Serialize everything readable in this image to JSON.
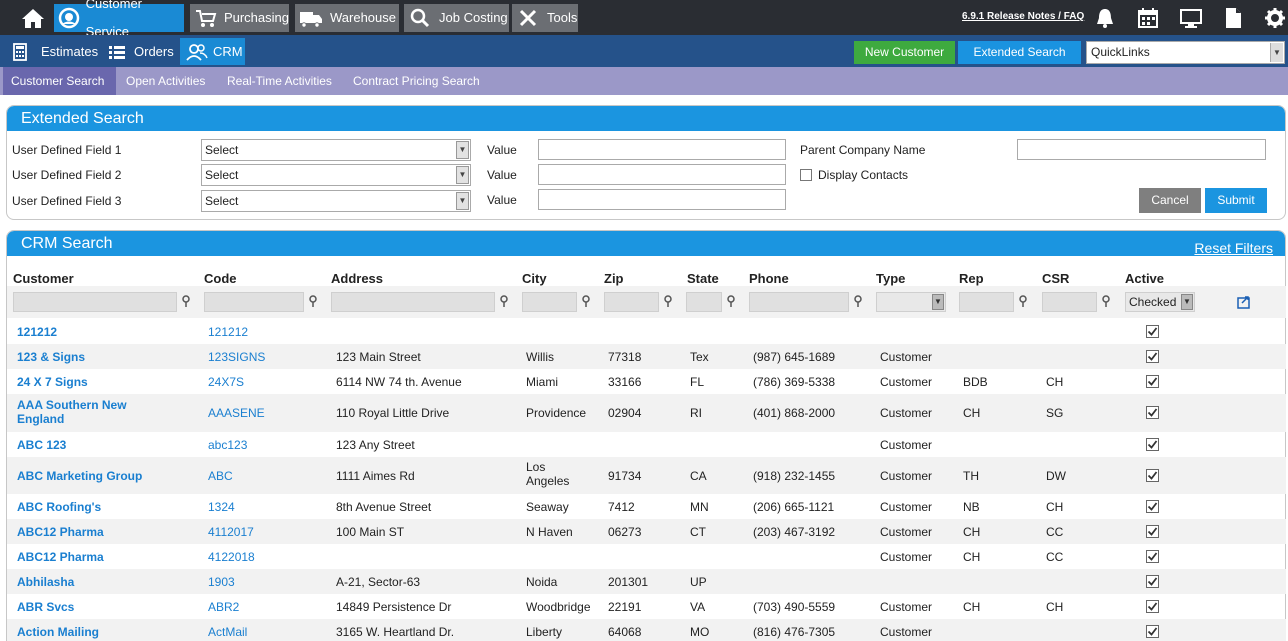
{
  "topnav": {
    "modules": [
      {
        "label": "Customer Service",
        "icon": "customer-service-icon",
        "active": true
      },
      {
        "label": "Purchasing",
        "icon": "cart-icon",
        "active": false
      },
      {
        "label": "Warehouse",
        "icon": "truck-icon",
        "active": false
      },
      {
        "label": "Job Costing",
        "icon": "magnifier-icon",
        "active": false
      },
      {
        "label": "Tools",
        "icon": "tools-icon",
        "active": false
      }
    ],
    "release_notes": "6.9.1 Release Notes / FAQ"
  },
  "subnav": {
    "items": [
      {
        "label": "Estimates",
        "icon": "calculator-icon"
      },
      {
        "label": "Orders",
        "icon": "list-icon"
      },
      {
        "label": "CRM",
        "icon": "users-icon"
      }
    ],
    "new_customer": "New Customer",
    "extended_search": "Extended Search",
    "quicklinks": "QuickLinks"
  },
  "tabs": [
    "Customer Search",
    "Open Activities",
    "Real-Time Activities",
    "Contract Pricing Search"
  ],
  "extended_search": {
    "title": "Extended Search",
    "udf1": "User Defined Field 1",
    "udf2": "User Defined Field 2",
    "udf3": "User Defined Field 3",
    "select": "Select",
    "value": "Value",
    "parent_company": "Parent Company Name",
    "display_contacts": "Display Contacts",
    "cancel": "Cancel",
    "submit": "Submit"
  },
  "crm": {
    "title": "CRM Search",
    "reset": "Reset Filters",
    "headers": [
      "Customer",
      "Code",
      "Address",
      "City",
      "Zip",
      "State",
      "Phone",
      "Type",
      "Rep",
      "CSR",
      "Active"
    ],
    "active_filter": "Checked",
    "rows": [
      {
        "customer": "121212",
        "code": "121212",
        "address": "",
        "city": "",
        "zip": "",
        "state": "",
        "phone": "",
        "type": "",
        "rep": "",
        "csr": ""
      },
      {
        "customer": "123 & Signs",
        "code": "123SIGNS",
        "address": "123 Main Street",
        "city": "Willis",
        "zip": "77318",
        "state": "Tex",
        "phone": "(987) 645-1689",
        "type": "Customer",
        "rep": "",
        "csr": ""
      },
      {
        "customer": "24 X 7 Signs",
        "code": "24X7S",
        "address": "6114 NW 74 th. Avenue",
        "city": "Miami",
        "zip": "33166",
        "state": "FL",
        "phone": "(786) 369-5338",
        "type": "Customer",
        "rep": "BDB",
        "csr": "CH"
      },
      {
        "customer": "AAA Southern New",
        "customer2": "England",
        "code": "AAASENE",
        "address": "110 Royal Little Drive",
        "city": "Providence",
        "zip": "02904",
        "state": "RI",
        "phone": "(401) 868-2000",
        "type": "Customer",
        "rep": "CH",
        "csr": "SG"
      },
      {
        "customer": "ABC 123",
        "code": "abc123",
        "address": "123 Any Street",
        "city": "",
        "zip": "",
        "state": "",
        "phone": "",
        "type": "Customer",
        "rep": "",
        "csr": ""
      },
      {
        "customer": "ABC Marketing Group",
        "code": "ABC",
        "address": "1111 Aimes Rd",
        "city": "Los",
        "city2": "Angeles",
        "zip": "91734",
        "state": "CA",
        "phone": "(918) 232-1455",
        "type": "Customer",
        "rep": "TH",
        "csr": "DW"
      },
      {
        "customer": "ABC Roofing's",
        "code": "1324",
        "address": "8th Avenue Street",
        "city": "Seaway",
        "zip": "7412",
        "state": "MN",
        "phone": "(206) 665-1121",
        "type": "Customer",
        "rep": "NB",
        "csr": "CH"
      },
      {
        "customer": "ABC12 Pharma",
        "code": "4112017",
        "address": "100 Main ST",
        "city": "N Haven",
        "zip": "06273",
        "state": "CT",
        "phone": "(203) 467-3192",
        "type": "Customer",
        "rep": "CH",
        "csr": "CC"
      },
      {
        "customer": "ABC12 Pharma",
        "code": "4122018",
        "address": "",
        "city": "",
        "zip": "",
        "state": "",
        "phone": "",
        "type": "Customer",
        "rep": "CH",
        "csr": "CC"
      },
      {
        "customer": "Abhilasha",
        "code": "1903",
        "address": "A-21, Sector-63",
        "city": "Noida",
        "zip": "201301",
        "state": "UP",
        "phone": "",
        "type": "",
        "rep": "",
        "csr": ""
      },
      {
        "customer": "ABR Svcs",
        "code": "ABR2",
        "address": "14849 Persistence Dr",
        "city": "Woodbridge",
        "zip": "22191",
        "state": "VA",
        "phone": "(703) 490-5559",
        "type": "Customer",
        "rep": "CH",
        "csr": "CH"
      },
      {
        "customer": "Action Mailing",
        "code": "ActMail",
        "address": "3165 W. Heartland Dr.",
        "city": "Liberty",
        "zip": "64068",
        "state": "MO",
        "phone": "(816) 476-7305",
        "type": "Customer",
        "rep": "",
        "csr": ""
      }
    ]
  }
}
